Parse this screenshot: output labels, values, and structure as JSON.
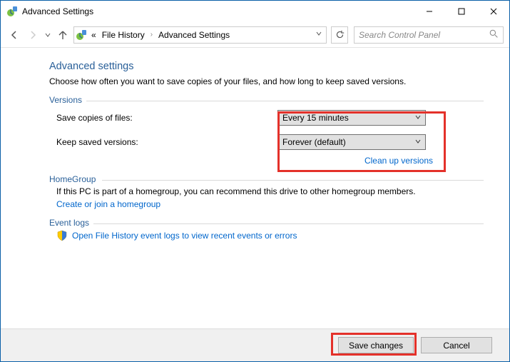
{
  "window": {
    "title": "Advanced Settings"
  },
  "breadcrumb": {
    "prefix": "«",
    "item1": "File History",
    "item2": "Advanced Settings"
  },
  "search": {
    "placeholder": "Search Control Panel"
  },
  "page": {
    "title": "Advanced settings",
    "desc": "Choose how often you want to save copies of your files, and how long to keep saved versions."
  },
  "versions": {
    "group_label": "Versions",
    "save_label": "Save copies of files:",
    "save_value": "Every 15 minutes",
    "keep_label": "Keep saved versions:",
    "keep_value": "Forever (default)",
    "cleanup_link": "Clean up versions"
  },
  "homegroup": {
    "group_label": "HomeGroup",
    "desc": "If this PC is part of a homegroup, you can recommend this drive to other homegroup members.",
    "link": "Create or join a homegroup"
  },
  "eventlogs": {
    "group_label": "Event logs",
    "link": "Open File History event logs to view recent events or errors"
  },
  "footer": {
    "save": "Save changes",
    "cancel": "Cancel"
  }
}
